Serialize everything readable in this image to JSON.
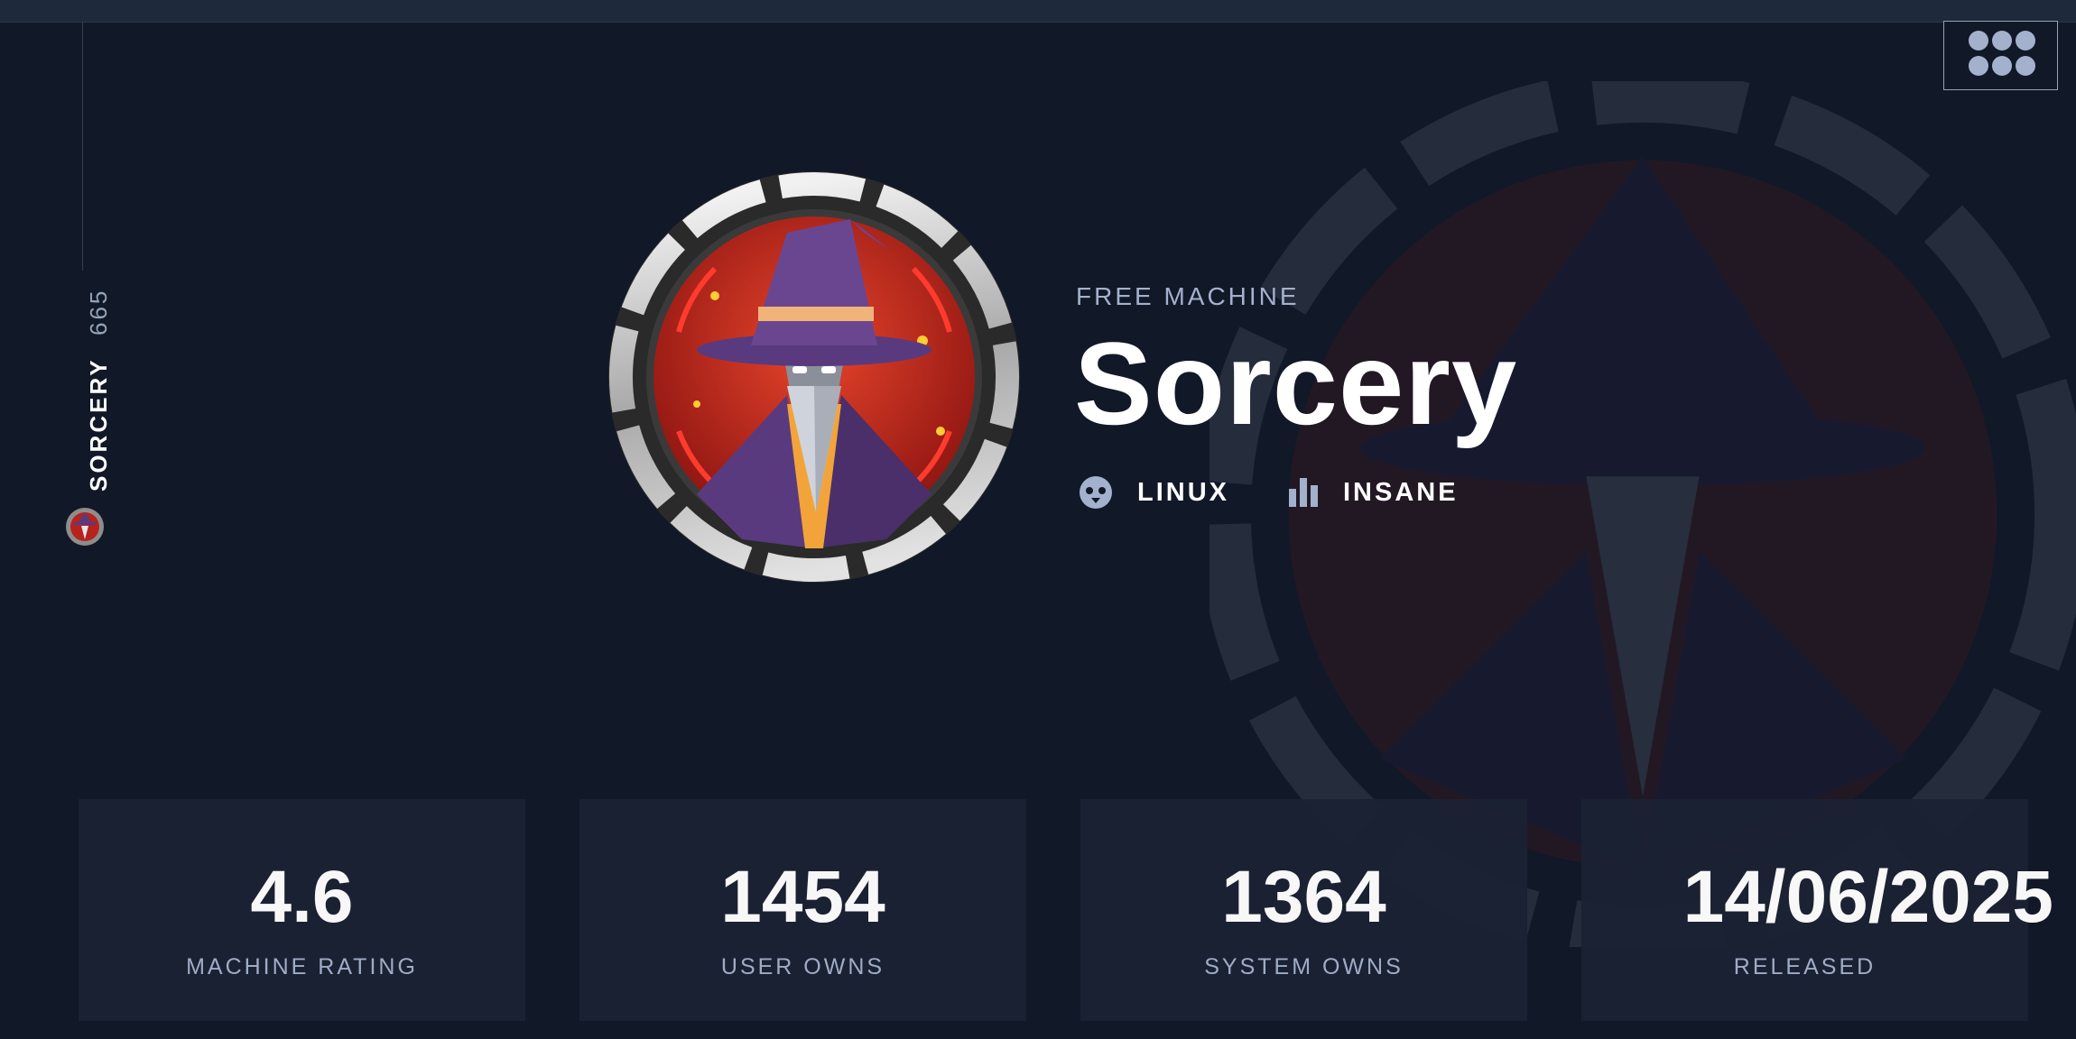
{
  "topbar": {},
  "sidebar": {
    "machine_name": "SORCERY",
    "machine_id": "665"
  },
  "header": {
    "grid_icon": "grid-menu-icon"
  },
  "hero": {
    "access_label": "FREE MACHINE",
    "title": "Sorcery",
    "os": {
      "icon": "linux-penguin-icon",
      "label": "LINUX"
    },
    "difficulty": {
      "icon": "bar-chart-icon",
      "label": "INSANE"
    }
  },
  "stats": [
    {
      "value": "4.6",
      "label": "MACHINE RATING"
    },
    {
      "value": "1454",
      "label": "USER OWNS"
    },
    {
      "value": "1364",
      "label": "SYSTEM OWNS"
    },
    {
      "value": "14/06/2025",
      "label": "RELEASED"
    }
  ],
  "colors": {
    "background": "#111827",
    "card": "#1b2233",
    "muted_text": "#a4b1cd",
    "avatar_red": "#b7221c",
    "avatar_purple": "#5a3a7e"
  }
}
